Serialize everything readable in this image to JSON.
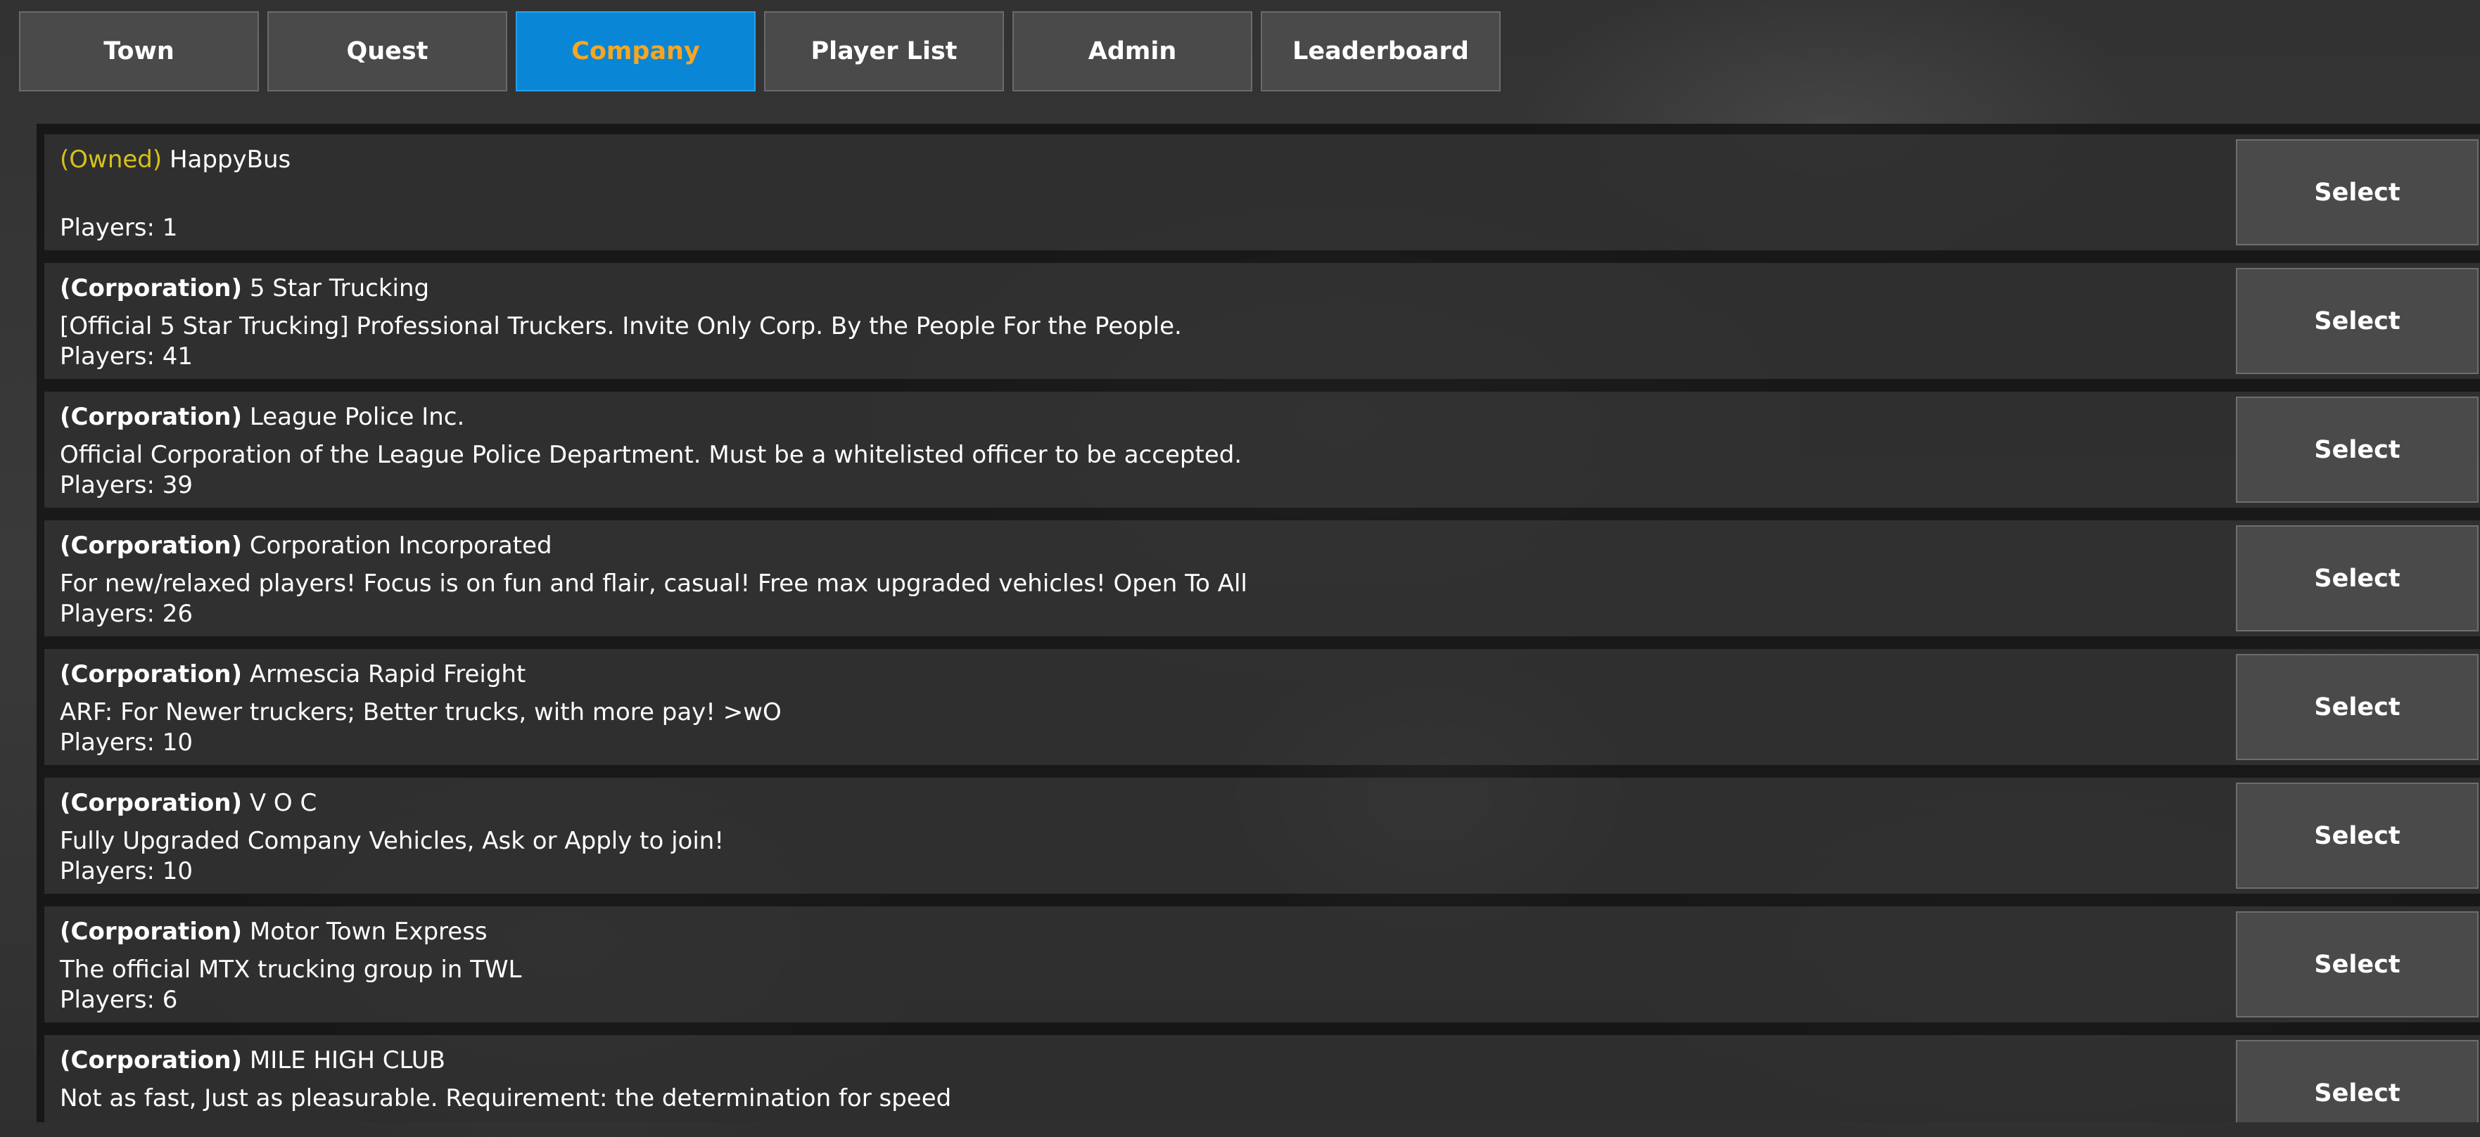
{
  "tabs": [
    {
      "label": "Town",
      "active": false
    },
    {
      "label": "Quest",
      "active": false
    },
    {
      "label": "Company",
      "active": true
    },
    {
      "label": "Player List",
      "active": false
    },
    {
      "label": "Admin",
      "active": false
    },
    {
      "label": "Leaderboard",
      "active": false
    }
  ],
  "companies": [
    {
      "tag": "(Owned)",
      "tag_style": "owned",
      "name": "HappyBus",
      "description": "",
      "players": "Players: 1",
      "select_label": "Select"
    },
    {
      "tag": "(Corporation)",
      "tag_style": "corp",
      "name": "5 Star Trucking",
      "description": "[Official 5 Star Trucking] Professional Truckers. Invite Only Corp. By the People For the People.",
      "players": "Players: 41",
      "select_label": "Select"
    },
    {
      "tag": "(Corporation)",
      "tag_style": "corp",
      "name": "League Police Inc.",
      "description": "Official Corporation of the League Police Department. Must be a whitelisted officer to be accepted.",
      "players": "Players: 39",
      "select_label": "Select"
    },
    {
      "tag": "(Corporation)",
      "tag_style": "corp",
      "name": "Corporation Incorporated",
      "description": "For new/relaxed players! Focus is on fun and flair, casual! Free max upgraded vehicles! Open To All",
      "players": "Players: 26",
      "select_label": "Select"
    },
    {
      "tag": "(Corporation)",
      "tag_style": "corp",
      "name": "Armescia Rapid Freight",
      "description": "ARF: For Newer truckers; Better trucks, with more pay! >wO",
      "players": "Players: 10",
      "select_label": "Select"
    },
    {
      "tag": "(Corporation)",
      "tag_style": "corp",
      "name": "V O C",
      "description": "Fully Upgraded Company Vehicles, Ask or Apply to join!",
      "players": "Players: 10",
      "select_label": "Select"
    },
    {
      "tag": "(Corporation)",
      "tag_style": "corp",
      "name": "Motor Town Express",
      "description": "The official MTX trucking group in TWL",
      "players": "Players: 6",
      "select_label": "Select"
    },
    {
      "tag": "(Corporation)",
      "tag_style": "corp",
      "name": "MILE HIGH CLUB",
      "description": "Not as fast, Just as pleasurable.  Requirement: the determination for speed",
      "players": "",
      "select_label": "Select"
    }
  ]
}
